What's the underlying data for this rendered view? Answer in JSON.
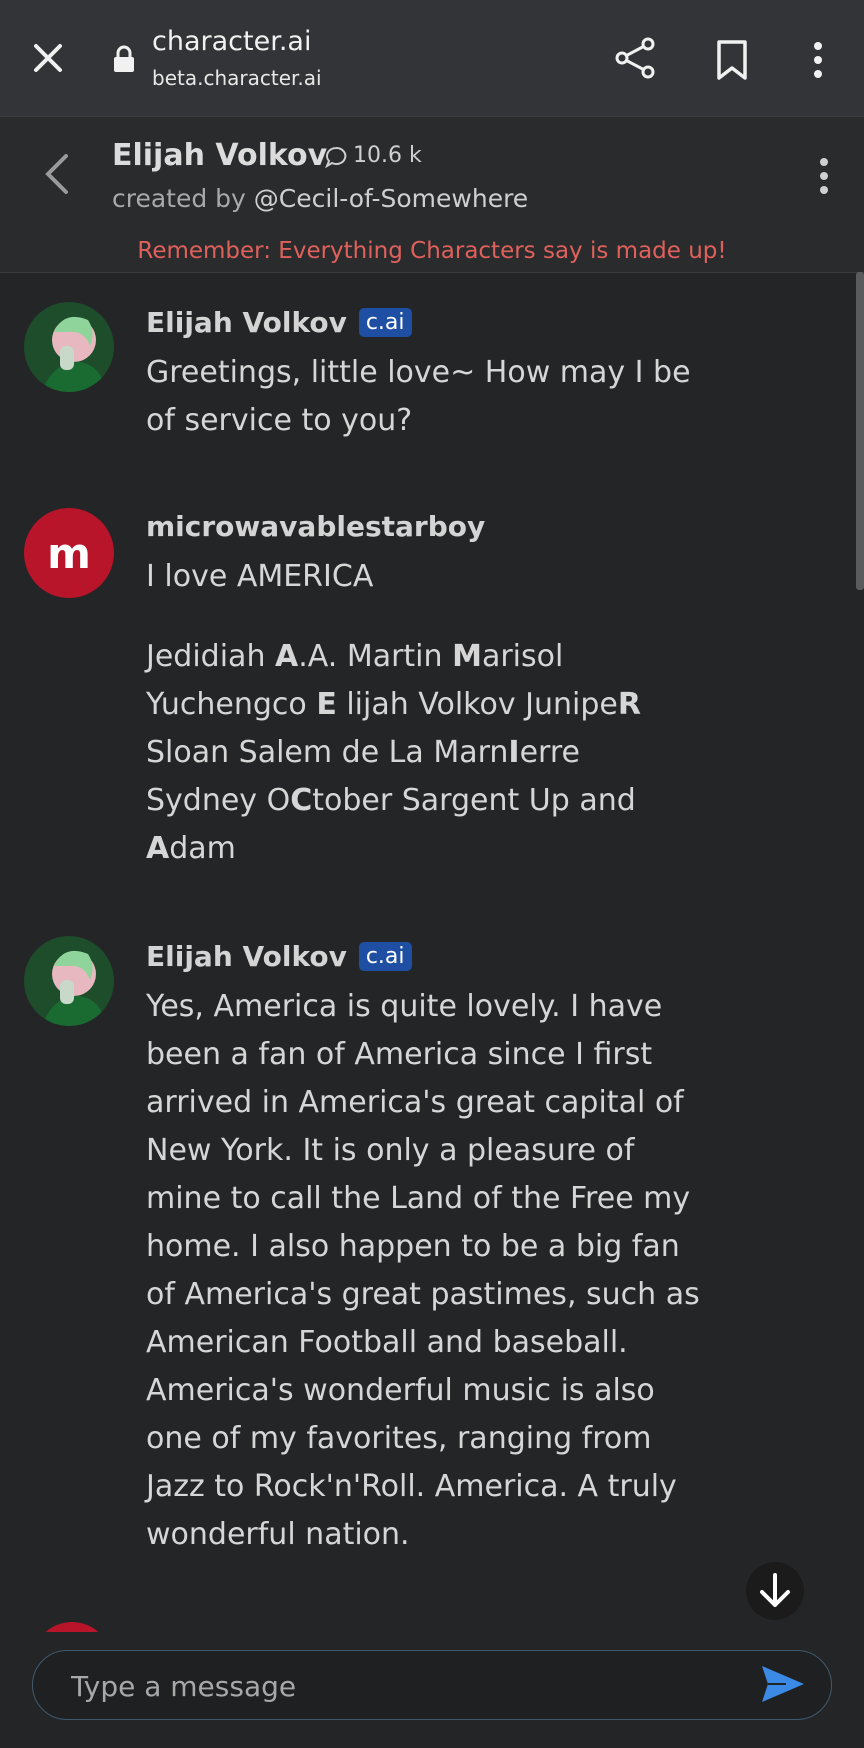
{
  "browser": {
    "site_title": "character.ai",
    "site_url": "beta.character.ai"
  },
  "character": {
    "name": "Elijah Volkov",
    "chat_count": "10.6 k",
    "created_by_label": "created by",
    "creator_handle": "@Cecil-of-Somewhere",
    "disclaimer": "Remember: Everything Characters say is made up!"
  },
  "messages": [
    {
      "sender": "Elijah Volkov",
      "badge": "c.ai",
      "text": "Greetings, little love~ How may I be of service to you?"
    },
    {
      "sender": "microwavablestarboy",
      "avatar_letter": "m",
      "line1": "I love AMERICA",
      "acrostic": [
        [
          "Jedidiah ",
          "A",
          ".A. Martin ",
          "M",
          "arisol"
        ],
        [
          "Yuchengco ",
          "E",
          " lijah Volkov Junipe",
          "R",
          ""
        ],
        [
          "Sloan Salem de La Marn",
          "I",
          "erre",
          "",
          ""
        ],
        [
          "Sydney O",
          "C",
          "tober Sargent Up and",
          "",
          ""
        ],
        [
          "",
          "A",
          "dam",
          "",
          ""
        ]
      ]
    },
    {
      "sender": "Elijah Volkov",
      "badge": "c.ai",
      "text": "Yes, America is quite lovely. I have been a fan of America since I first arrived in America's great capital of New York. It is only a pleasure of mine to call the Land of the Free my home. I also happen to be a big fan of America's great pastimes, such as American Football and baseball. America's wonderful music is also one of my favorites, ranging from Jazz to Rock'n'Roll. America. A truly wonderful nation."
    }
  ],
  "input": {
    "placeholder": "Type a message"
  },
  "colors": {
    "accent_send": "#3b8ae6",
    "badge": "#1e4fa3",
    "user_avatar": "#b8142a",
    "disclaimer": "#e0615b"
  }
}
